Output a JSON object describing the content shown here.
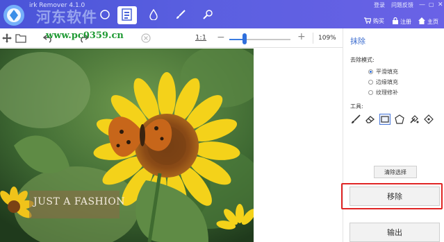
{
  "header": {
    "app_title": "irk Remover 4.1.0",
    "watermark_site": "河东软件",
    "watermark_url": "www.pc0359.cn",
    "top_links": [
      "登录",
      "问题反馈"
    ],
    "buy_label": "购买",
    "register_label": "注册",
    "home_label": "主页"
  },
  "toolbar": {
    "zoom_fit": "1:1",
    "zoom_minus": "−",
    "zoom_plus": "+",
    "zoom_level": 0.25,
    "zoom_percent": "109%"
  },
  "image": {
    "watermark_text": "JUST A FASHION"
  },
  "panel": {
    "title": "抹除",
    "mode_label": "去除模式:",
    "modes": [
      {
        "label": "平滑填充",
        "selected": true
      },
      {
        "label": "边缘填充",
        "selected": false
      },
      {
        "label": "纹理修补",
        "selected": false
      }
    ],
    "tools_label": "工具:",
    "tools": [
      "brush-icon",
      "eraser-icon",
      "rectangle-select-icon",
      "polygon-select-icon",
      "magic-fill-icon",
      "points-select-icon"
    ],
    "active_tool": "rectangle-select-icon",
    "reset_label": "清除选择",
    "remove_label": "移除",
    "export_label": "输出"
  },
  "colors": {
    "header_start": "#4a54d8",
    "header_end": "#6a62e6",
    "accent": "#3f6fd0",
    "highlight": "#e02424"
  }
}
